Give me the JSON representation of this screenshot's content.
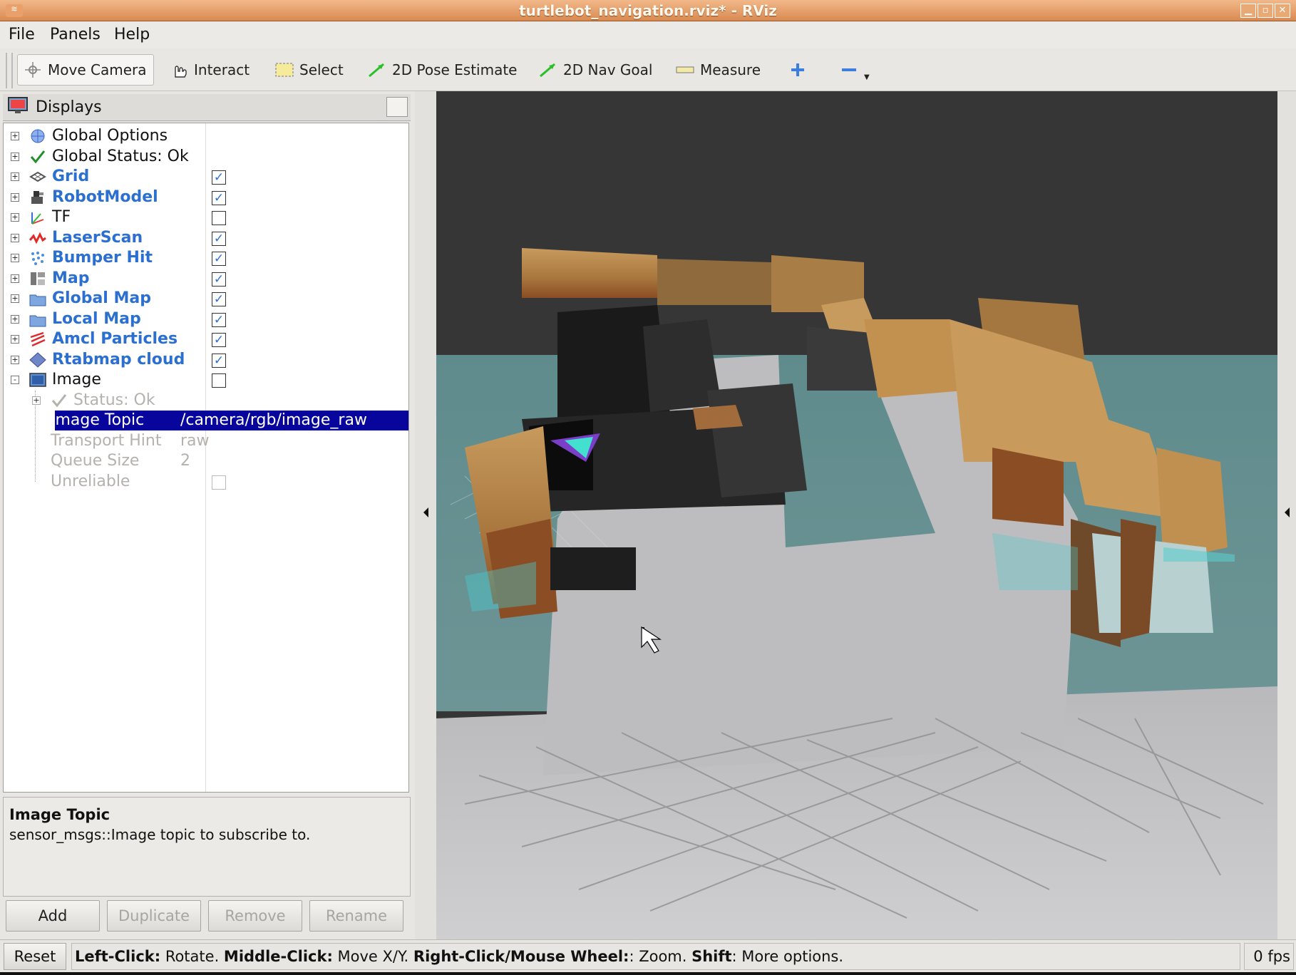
{
  "window": {
    "title": "turtlebot_navigation.rviz* - RViz"
  },
  "menu": [
    "File",
    "Panels",
    "Help"
  ],
  "toolbar": {
    "tools": [
      {
        "label": "Move Camera",
        "icon": "move-camera-icon",
        "active": true
      },
      {
        "label": "Interact",
        "icon": "hand-icon"
      },
      {
        "label": "Select",
        "icon": "select-box-icon"
      },
      {
        "label": "2D Pose Estimate",
        "icon": "green-arrow-icon"
      },
      {
        "label": "2D Nav Goal",
        "icon": "green-arrow-icon"
      },
      {
        "label": "Measure",
        "icon": "ruler-icon"
      }
    ],
    "add_tool_icon": "plus-icon",
    "remove_tool_icon": "minus-icon"
  },
  "displays": {
    "title": "Displays",
    "items": [
      {
        "label": "Global Options",
        "icon": "globe-icon",
        "expander": "+",
        "style": "normal"
      },
      {
        "label": "Global Status: Ok",
        "icon": "checkmark-icon",
        "expander": "+",
        "style": "normal"
      },
      {
        "label": "Grid",
        "icon": "grid-icon",
        "expander": "+",
        "style": "blue",
        "checked": true
      },
      {
        "label": "RobotModel",
        "icon": "robot-icon",
        "expander": "+",
        "style": "blue",
        "checked": true
      },
      {
        "label": "TF",
        "icon": "axes-icon",
        "expander": "+",
        "style": "normal",
        "checked": false
      },
      {
        "label": "LaserScan",
        "icon": "laser-icon",
        "expander": "+",
        "style": "blue",
        "checked": true
      },
      {
        "label": "Bumper Hit",
        "icon": "dots-icon",
        "expander": "+",
        "style": "blue",
        "checked": true
      },
      {
        "label": "Map",
        "icon": "map-icon",
        "expander": "+",
        "style": "blue",
        "checked": true
      },
      {
        "label": "Global Map",
        "icon": "folder-icon",
        "expander": "+",
        "style": "blue",
        "checked": true
      },
      {
        "label": "Local Map",
        "icon": "folder-icon",
        "expander": "+",
        "style": "blue",
        "checked": true
      },
      {
        "label": "Amcl Particles",
        "icon": "particles-icon",
        "expander": "+",
        "style": "blue",
        "checked": true
      },
      {
        "label": "Rtabmap cloud",
        "icon": "diamond-icon",
        "expander": "+",
        "style": "blue",
        "checked": true
      },
      {
        "label": "Image",
        "icon": "image-icon",
        "expander": "-",
        "style": "normal",
        "checked": false
      }
    ],
    "image_children": [
      {
        "label": "Status: Ok",
        "value": "",
        "kind": "status"
      },
      {
        "label": "Image Topic",
        "value": "/camera/rgb/image_raw",
        "kind": "selected"
      },
      {
        "label": "Transport Hint",
        "value": "raw",
        "kind": "dim"
      },
      {
        "label": "Queue Size",
        "value": "2",
        "kind": "dim"
      },
      {
        "label": "Unreliable",
        "value": "",
        "kind": "checkbox"
      }
    ]
  },
  "description": {
    "title": "Image Topic",
    "text": "sensor_msgs::Image topic to subscribe to."
  },
  "panel_buttons": {
    "add": "Add",
    "duplicate": "Duplicate",
    "remove": "Remove",
    "rename": "Rename"
  },
  "statusbar": {
    "reset": "Reset",
    "hint": [
      {
        "b": "Left-Click:",
        "t": " Rotate. "
      },
      {
        "b": "Middle-Click:",
        "t": " Move X/Y. "
      },
      {
        "b": "Right-Click/Mouse Wheel:",
        "t": ": Zoom. "
      },
      {
        "b": "Shift",
        "t": ": More options."
      }
    ],
    "fps": "0 fps"
  },
  "colors": {
    "selection": "#07059c",
    "blue_label": "#2b6fd0",
    "sky": "#363636",
    "floor_far": "#5f8b8c",
    "floor_near": "#c9c9cb",
    "titlebar": "#d98a52"
  }
}
